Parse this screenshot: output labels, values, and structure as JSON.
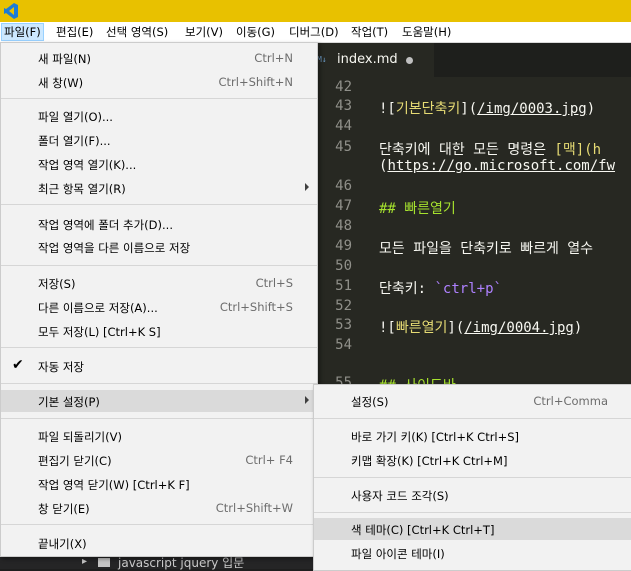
{
  "menubar": {
    "items": [
      "파일(F)",
      "편집(E)",
      "선택 영역(S)",
      "보기(V)",
      "이동(G)",
      "디버그(D)",
      "작업(T)",
      "도움말(H)"
    ]
  },
  "file_menu": {
    "new_file": {
      "label": "새 파일(N)",
      "accel": "Ctrl+N"
    },
    "new_window": {
      "label": "새 창(W)",
      "accel": "Ctrl+Shift+N"
    },
    "open_file": {
      "label": "파일 열기(O)..."
    },
    "open_folder": {
      "label": "폴더 열기(F)..."
    },
    "open_workspace": {
      "label": "작업 영역 열기(K)..."
    },
    "open_recent": {
      "label": "최근 항목 열기(R)"
    },
    "add_folder": {
      "label": "작업 영역에 폴더 추가(D)..."
    },
    "save_workspace_as": {
      "label": "작업 영역을 다른 이름으로 저장"
    },
    "save": {
      "label": "저장(S)",
      "accel": "Ctrl+S"
    },
    "save_as": {
      "label": "다른 이름으로 저장(A)...",
      "accel": "Ctrl+Shift+S"
    },
    "save_all": {
      "label": "모두 저장(L) [Ctrl+K S]"
    },
    "auto_save": {
      "label": "자동 저장",
      "check": "✔"
    },
    "preferences": {
      "label": "기본 설정(P)"
    },
    "revert_file": {
      "label": "파일 되돌리기(V)"
    },
    "close_editor": {
      "label": "편집기 닫기(C)",
      "accel": "Ctrl+  F4"
    },
    "close_workspace": {
      "label": "작업 영역 닫기(W) [Ctrl+K F]"
    },
    "close_window": {
      "label": "창 닫기(E)",
      "accel": "Ctrl+Shift+W"
    },
    "exit": {
      "label": "끝내기(X)"
    }
  },
  "pref_menu": {
    "settings": {
      "label": "설정(S)",
      "accel": "Ctrl+Comma"
    },
    "keyboard_shortcuts": {
      "label": "바로 가기 키(K) [Ctrl+K Ctrl+S]"
    },
    "keymaps": {
      "label": "키맵 확장(K) [Ctrl+K Ctrl+M]"
    },
    "user_snippets": {
      "label": "사용자 코드 조각(S)"
    },
    "color_theme": {
      "label": "색 테마(C) [Ctrl+K Ctrl+T]"
    },
    "file_icon_theme": {
      "label": "파일 아이콘 테마(I)"
    }
  },
  "editor": {
    "tab": {
      "icon": "M↓",
      "label": "index.md"
    },
    "lines": {
      "l42": {
        "n": "42"
      },
      "l43": {
        "n": "43",
        "a": "![",
        "b": "기본단축키",
        "c": "](",
        "d": "/img/0003.jpg",
        "e": ")"
      },
      "l44": {
        "n": "44"
      },
      "l45": {
        "n": "45",
        "a": "단축키에 대한 모든 명령은 ",
        "b": "[맥](h"
      },
      "l45b": {
        "a": "(",
        "b": "https://go.microsoft.com/fw"
      },
      "l46": {
        "n": "46"
      },
      "l47": {
        "n": "47",
        "a": "## 빠른열기"
      },
      "l48": {
        "n": "48"
      },
      "l49": {
        "n": "49",
        "a": "모든 파일을 단축키로 빠르게 열수"
      },
      "l50": {
        "n": "50"
      },
      "l51": {
        "n": "51",
        "a": "단축키: ",
        "b": "`ctrl+p`"
      },
      "l52": {
        "n": "52"
      },
      "l53": {
        "n": "53",
        "a": "![",
        "b": "빠른열기",
        "c": "](",
        "d": "/img/0004.jpg",
        "e": ")"
      },
      "l54": {
        "n": "54"
      },
      "l55": {
        "n": "55",
        "a": "## 사이드바"
      }
    }
  },
  "sidebar": {
    "peek_item": "javascript jquery 입문"
  },
  "colors": {
    "titlebar": "#e8c100",
    "menu_bg": "#f2f2f2",
    "editor_bg": "#272822",
    "highlight": "#dadada"
  }
}
